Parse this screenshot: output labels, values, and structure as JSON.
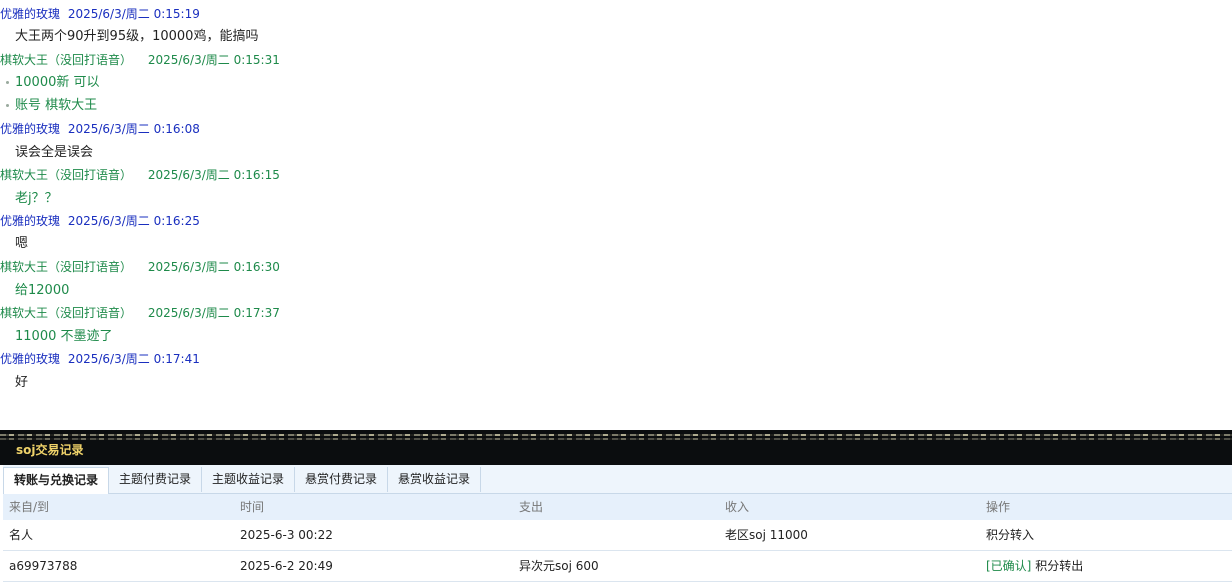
{
  "chat": {
    "messages": [
      {
        "sender": "优雅的玫瑰",
        "time": "2025/6/3/周二 0:15:19",
        "lines": [
          "大王两个90升到95级，10000鸡，能搞吗"
        ]
      },
      {
        "sender": "棋软大王（没回打语音）",
        "time": "2025/6/3/周二 0:15:31",
        "lines": [
          "10000新  可以",
          "账号 棋软大王"
        ]
      },
      {
        "sender": "优雅的玫瑰",
        "time": "2025/6/3/周二 0:16:08",
        "lines": [
          "误会全是误会"
        ]
      },
      {
        "sender": "棋软大王（没回打语音）",
        "time": "2025/6/3/周二 0:16:15",
        "lines": [
          "老j？？"
        ]
      },
      {
        "sender": "优雅的玫瑰",
        "time": "2025/6/3/周二 0:16:25",
        "lines": [
          "嗯"
        ]
      },
      {
        "sender": "棋软大王（没回打语音）",
        "time": "2025/6/3/周二 0:16:30",
        "lines": [
          "给12000"
        ]
      },
      {
        "sender": "棋软大王（没回打语音）",
        "time": "2025/6/3/周二 0:17:37",
        "lines": [
          "11000 不墨迹了"
        ]
      },
      {
        "sender": "优雅的玫瑰",
        "time": "2025/6/3/周二 0:17:41",
        "lines": [
          "好"
        ]
      }
    ]
  },
  "panel": {
    "title": "soj交易记录",
    "tabs": [
      "转账与兑换记录",
      "主题付费记录",
      "主题收益记录",
      "悬赏付费记录",
      "悬赏收益记录"
    ],
    "active_tab": 0,
    "columns": [
      "来自/到",
      "时间",
      "支出",
      "收入",
      "操作"
    ],
    "rows": [
      {
        "from": "名人",
        "time": "2025-6-3 00:22",
        "expense": "",
        "income": "老区soj 11000",
        "status": "",
        "action": "积分转入"
      },
      {
        "from": "a69973788",
        "time": "2025-6-2 20:49",
        "expense": "异次元soj 600",
        "income": "",
        "status": "[已确认]",
        "action": "积分转出"
      }
    ]
  },
  "colors": {
    "sender_blue": "#1a2fbf",
    "sender_green": "#1e8a4a",
    "panel_title": "#f0d36a",
    "confirmed": "#1e8a4a"
  }
}
